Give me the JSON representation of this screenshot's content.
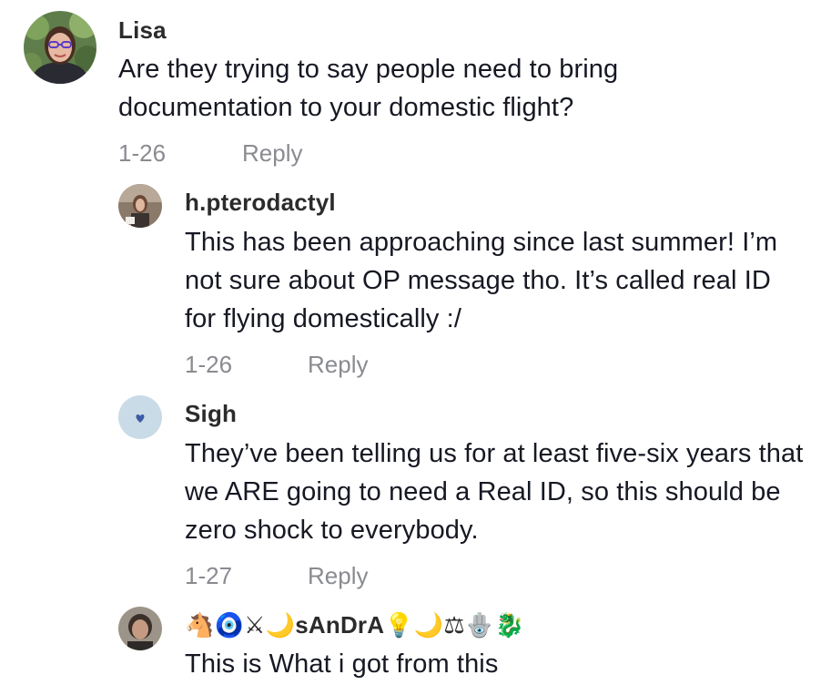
{
  "comments": [
    {
      "username": "Lisa",
      "text": "Are they trying to say people need to bring documentation to your domestic flight?",
      "date": "1-26",
      "reply_label": "Reply",
      "avatar_icon": "profile-photo-woman-glasses"
    },
    {
      "username": "h.pterodactyl",
      "text": "This has been approaching since last summer! I’m not sure about OP message tho. It’s called real ID for flying domestically :/",
      "date": "1-26",
      "reply_label": "Reply",
      "avatar_icon": "profile-photo"
    },
    {
      "username": "Sigh",
      "text": "They’ve been telling us for at least five-six years that we ARE going to need a Real ID, so this should be zero shock to everybody.",
      "date": "1-27",
      "reply_label": "Reply",
      "avatar_icon": "heart-icon"
    },
    {
      "username": "🐴🧿⚔🌙sAnDrA💡🌙⚖🪬🐉",
      "text": "This is What i got from this",
      "avatar_icon": "profile-photo"
    }
  ],
  "colors": {
    "text": "#161823",
    "username": "#2b2b2b",
    "meta": "#8a8b91",
    "sigh_avatar_bg": "#c9dbe6",
    "sigh_heart": "#3d5aa6"
  }
}
